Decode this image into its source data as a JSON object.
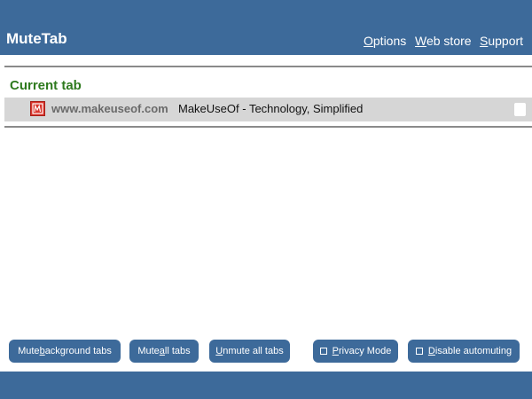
{
  "app": {
    "title": "MuteTab"
  },
  "nav": {
    "options": {
      "key": "O",
      "rest": "ptions"
    },
    "webstore": {
      "key": "W",
      "rest": "eb store"
    },
    "support": {
      "key": "S",
      "rest": "upport"
    }
  },
  "current_tab": {
    "heading": "Current tab",
    "domain": "www.makeuseof.com",
    "title": "MakeUseOf - Technology, Simplified",
    "favicon": "makeuseof-favicon",
    "muted": false
  },
  "buttons": {
    "mute_background": {
      "pre": "Mute ",
      "key": "b",
      "post": "ackground tabs"
    },
    "mute_all": {
      "pre": "Mute ",
      "key": "a",
      "post": "ll tabs"
    },
    "unmute_all": {
      "pre": "",
      "key": "U",
      "post": "nmute all tabs"
    },
    "privacy_mode": {
      "pre": "",
      "key": "P",
      "post": "rivacy Mode",
      "checked": false
    },
    "disable_automuting": {
      "pre": "",
      "key": "D",
      "post": "isable automuting",
      "checked": false
    }
  },
  "colors": {
    "header": "#3d6a9a",
    "section_title": "#2e7a1e",
    "row_bg": "#d6d6d6"
  }
}
